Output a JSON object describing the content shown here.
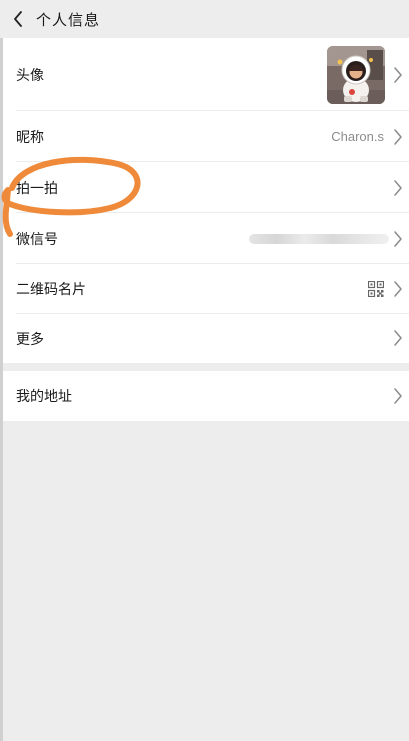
{
  "header": {
    "title": "个人信息",
    "back_icon": "chevron-left-icon"
  },
  "profile": {
    "avatar_label": "头像",
    "nickname_label": "昵称",
    "nickname_value": "Charon.s",
    "pat_label": "拍一拍",
    "wechat_id_label": "微信号",
    "qr_label": "二维码名片",
    "more_label": "更多"
  },
  "address": {
    "label": "我的地址"
  },
  "colors": {
    "annotation": "#ef8a3a",
    "background": "#ededed",
    "row": "#ffffff"
  }
}
